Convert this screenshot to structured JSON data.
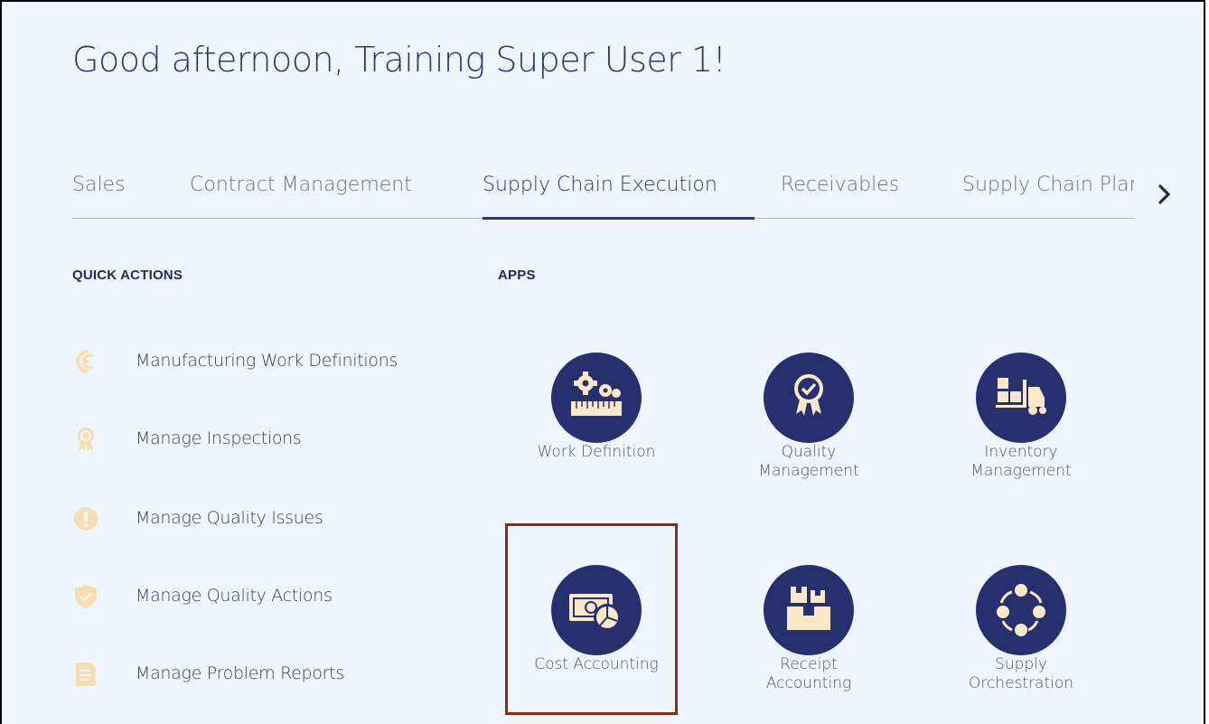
{
  "greeting": "Good afternoon, Training Super User 1!",
  "tabs": [
    {
      "label": "Sales",
      "active": false
    },
    {
      "label": "Contract Management",
      "active": false
    },
    {
      "label": "Supply Chain Execution",
      "active": true
    },
    {
      "label": "Receivables",
      "active": false
    },
    {
      "label": "Supply Chain Plar",
      "active": false
    }
  ],
  "next_icon": "chevron-right-icon",
  "quick_actions": {
    "title": "QUICK ACTIONS",
    "items": [
      {
        "label": "Manufacturing Work Definitions",
        "icon": "work-definitions-icon"
      },
      {
        "label": "Manage Inspections",
        "icon": "inspection-ribbon-icon"
      },
      {
        "label": "Manage Quality Issues",
        "icon": "exclamation-icon"
      },
      {
        "label": "Manage Quality Actions",
        "icon": "shield-check-icon"
      },
      {
        "label": "Manage Problem Reports",
        "icon": "document-edit-icon"
      }
    ]
  },
  "apps": {
    "title": "APPS",
    "items": [
      {
        "label_line1": "Work Definition",
        "label_line2": "",
        "icon": "gears-ruler-icon"
      },
      {
        "label_line1": "Quality",
        "label_line2": "Management",
        "icon": "award-ribbon-icon"
      },
      {
        "label_line1": "Inventory",
        "label_line2": "Management",
        "icon": "forklift-icon"
      },
      {
        "label_line1": "Cost Accounting",
        "label_line2": "",
        "icon": "money-pie-icon"
      },
      {
        "label_line1": "Receipt",
        "label_line2": "Accounting",
        "icon": "boxes-icon"
      },
      {
        "label_line1": "Supply",
        "label_line2": "Orchestration",
        "icon": "cycle-nodes-icon"
      }
    ]
  },
  "colors": {
    "background": "#eef5fc",
    "accent": "#26306e",
    "icon_fill": "#fbe8c8",
    "quick_action_icon": "#f7deb2",
    "highlight": "#8a2a14"
  }
}
